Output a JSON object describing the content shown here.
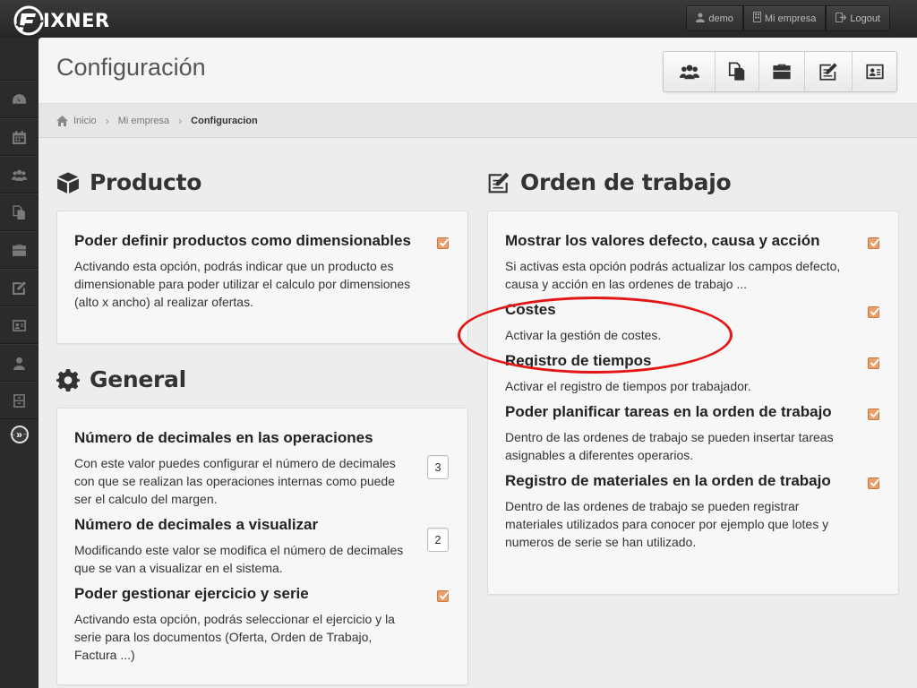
{
  "app": {
    "logo_text": "IXNER"
  },
  "top_actions": [
    {
      "label": "demo",
      "icon": "user-icon"
    },
    {
      "label": "Mi empresa",
      "icon": "building-icon"
    },
    {
      "label": "Logout",
      "icon": "logout-icon"
    }
  ],
  "rail": [
    {
      "icon": "dashboard-icon"
    },
    {
      "icon": "calendar-icon"
    },
    {
      "icon": "users-icon"
    },
    {
      "icon": "documents-icon"
    },
    {
      "icon": "briefcase-icon"
    },
    {
      "icon": "edit-icon"
    },
    {
      "icon": "contact-card-icon"
    },
    {
      "icon": "person-icon"
    },
    {
      "icon": "archive-icon"
    }
  ],
  "page": {
    "title": "Configuración"
  },
  "toolbar": [
    {
      "icon": "users-icon"
    },
    {
      "icon": "documents-icon"
    },
    {
      "icon": "briefcase-icon"
    },
    {
      "icon": "edit-icon"
    },
    {
      "icon": "contact-card-icon"
    }
  ],
  "breadcrumb": {
    "home": "Inicio",
    "level1": "Mi empresa",
    "current": "Configuracion"
  },
  "producto": {
    "title": "Producto",
    "options": [
      {
        "title": "Poder definir productos como dimensionables",
        "desc": "Activando esta opción, podrás indicar que un producto es dimensionable para poder utilizar el calculo por dimensiones (alto x ancho) al realizar ofertas.",
        "checked": true
      }
    ]
  },
  "general": {
    "title": "General",
    "options": [
      {
        "title": "Número de decimales en las operaciones",
        "desc": "Con este valor puedes configurar el número de decimales con que se realizan las operaciones internas como puede ser el calculo del margen.",
        "value": "3"
      },
      {
        "title": "Número de decimales a visualizar",
        "desc": "Modificando este valor se modifica el número de decimales que se van a visualizar en el sistema.",
        "value": "2"
      },
      {
        "title": "Poder gestionar ejercicio y serie",
        "desc": "Activando esta opción, podrás seleccionar el ejercicio y la serie para los documentos (Oferta, Orden de Trabajo, Factura ...)",
        "checked": true
      }
    ]
  },
  "orden": {
    "title": "Orden de trabajo",
    "options": [
      {
        "title": "Mostrar los valores defecto, causa y acción",
        "desc": "Si activas esta opción podrás actualizar los campos defecto, causa y acción en las ordenes de trabajo ...",
        "checked": true
      },
      {
        "title": "Costes",
        "desc": "Activar la gestión de costes.",
        "checked": true
      },
      {
        "title": "Registro de tiempos",
        "desc": "Activar el registro de tiempos por trabajador.",
        "checked": true
      },
      {
        "title": "Poder planificar tareas en la orden de trabajo",
        "desc": "Dentro de las ordenes de trabajo se pueden insertar tareas asignables a diferentes operarios.",
        "checked": true
      },
      {
        "title": "Registro de materiales en la orden de trabajo",
        "desc": "Dentro de las ordenes de trabajo se pueden registrar materiales utilizados para conocer por ejemplo que lotes y numeros de serie se han utilizado.",
        "checked": true
      }
    ]
  },
  "colors": {
    "accent": "#e9a06a",
    "annotation": "#e31616"
  }
}
